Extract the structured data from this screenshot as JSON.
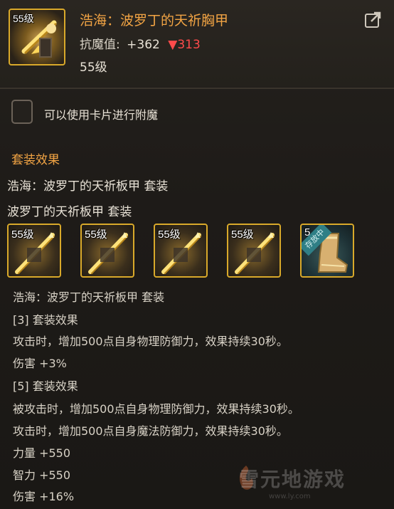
{
  "item": {
    "level_badge": "55级",
    "title": "浩海：波罗丁的天祈胸甲",
    "stat_label": "抗魔值:",
    "stat_up": "+362",
    "stat_down": "▼313",
    "level_text": "55级"
  },
  "card": {
    "label": "可以使用卡片进行附魔",
    "checked": false
  },
  "set": {
    "heading": "套装效果",
    "set_name_full": "浩海：波罗丁的天祈板甲  套装",
    "set_name_short": "波罗丁的天祈板甲  套装",
    "slots": [
      {
        "level": "55级",
        "icon": "sword-icon"
      },
      {
        "level": "55级",
        "icon": "sword-icon"
      },
      {
        "level": "55级",
        "icon": "sword-icon"
      },
      {
        "level": "55级",
        "icon": "sword-icon"
      },
      {
        "level": "5",
        "icon": "boot-icon",
        "ribbon": "存放中"
      }
    ],
    "detail_title": "浩海：波罗丁的天祈板甲  套装",
    "bonus3_title": "[3] 套装效果",
    "bonus3_lines": [
      "攻击时，增加500点自身物理防御力，效果持续30秒。",
      "伤害 +3%"
    ],
    "bonus5_title": "[5] 套装效果",
    "bonus5_lines": [
      "被攻击时，增加500点自身物理防御力，效果持续30秒。",
      "攻击时，增加500点自身魔法防御力，效果持续30秒。",
      "力量 +550",
      "智力 +550",
      "伤害 +16%"
    ]
  },
  "watermark": {
    "text": "雪元地游戏",
    "sub": "www.ly.com"
  },
  "colors": {
    "title": "#f2a444",
    "frame": "#d9a92a",
    "down": "#ff4b4b"
  }
}
